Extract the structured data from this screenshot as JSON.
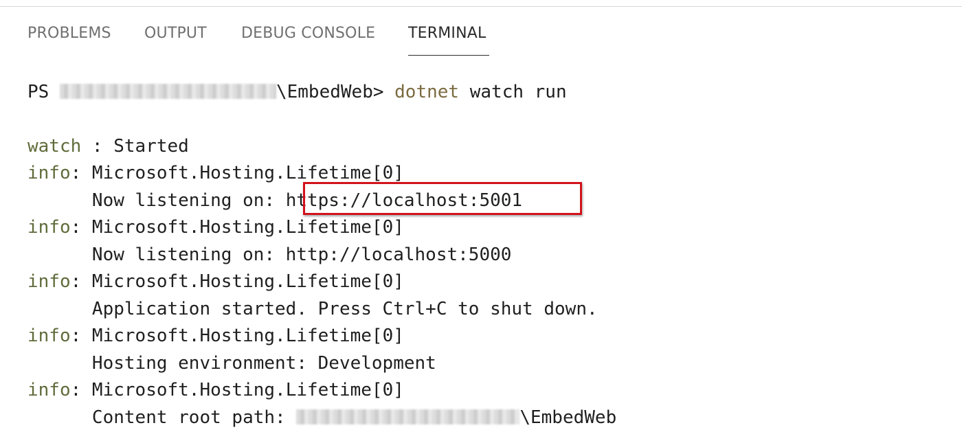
{
  "panel": {
    "tabs": [
      {
        "label": "PROBLEMS",
        "active": false
      },
      {
        "label": "OUTPUT",
        "active": false
      },
      {
        "label": "DEBUG CONSOLE",
        "active": false
      },
      {
        "label": "TERMINAL",
        "active": true
      }
    ]
  },
  "terminal": {
    "prompt": {
      "prefix": "PS ",
      "path_suffix": "\\EmbedWeb> ",
      "command": "dotnet",
      "args": " watch run"
    },
    "lines": [
      {
        "label": "watch",
        "text": " : Started"
      },
      {
        "label": "info",
        "text": ": Microsoft.Hosting.Lifetime[0]"
      },
      {
        "indent": "      ",
        "text": "Now listening on: ",
        "url": "https://localhost:5001"
      },
      {
        "label": "info",
        "text": ": Microsoft.Hosting.Lifetime[0]"
      },
      {
        "indent": "      ",
        "text": "Now listening on: http://localhost:5000"
      },
      {
        "label": "info",
        "text": ": Microsoft.Hosting.Lifetime[0]"
      },
      {
        "indent": "      ",
        "text": "Application started. Press Ctrl+C to shut down."
      },
      {
        "label": "info",
        "text": ": Microsoft.Hosting.Lifetime[0]"
      },
      {
        "indent": "      ",
        "text": "Hosting environment: Development"
      },
      {
        "label": "info",
        "text": ": Microsoft.Hosting.Lifetime[0]"
      },
      {
        "indent": "      ",
        "text": "Content root path: ",
        "path_suffix": "\\EmbedWeb"
      }
    ]
  },
  "colors": {
    "highlight": "#d1121b",
    "info_label": "#5f6b3a",
    "command": "#7b6b40"
  }
}
